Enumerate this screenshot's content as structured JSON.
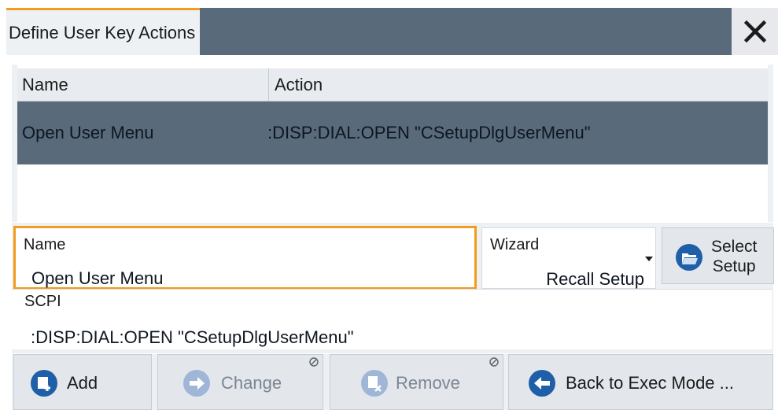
{
  "dialog": {
    "title": "Define User Key Actions",
    "close_icon": "close-icon",
    "accent_color": "#f29b1d",
    "header_color": "#596a7b"
  },
  "table": {
    "columns": [
      "Name",
      "Action"
    ],
    "rows": [
      {
        "name": "Open User Menu",
        "action": ":DISP:DIAL:OPEN \"CSetupDlgUserMenu\"",
        "selected": true
      }
    ]
  },
  "edit": {
    "name_label": "Name",
    "name_value": "Open User Menu",
    "wizard_label": "Wizard",
    "wizard_value": "Recall Setup",
    "select_setup_line1": "Select",
    "select_setup_line2": "Setup",
    "select_setup_icon": "folder-open-icon",
    "scpi_label": "SCPI",
    "scpi_value": ":DISP:DIAL:OPEN \"CSetupDlgUserMenu\""
  },
  "buttons": {
    "add": {
      "label": "Add",
      "icon": "add-icon",
      "enabled": true
    },
    "change": {
      "label": "Change",
      "icon": "change-icon",
      "enabled": false
    },
    "remove": {
      "label": "Remove",
      "icon": "remove-icon",
      "enabled": false
    },
    "back": {
      "label": "Back to Exec Mode ...",
      "icon": "back-arrow-icon",
      "enabled": true
    }
  }
}
